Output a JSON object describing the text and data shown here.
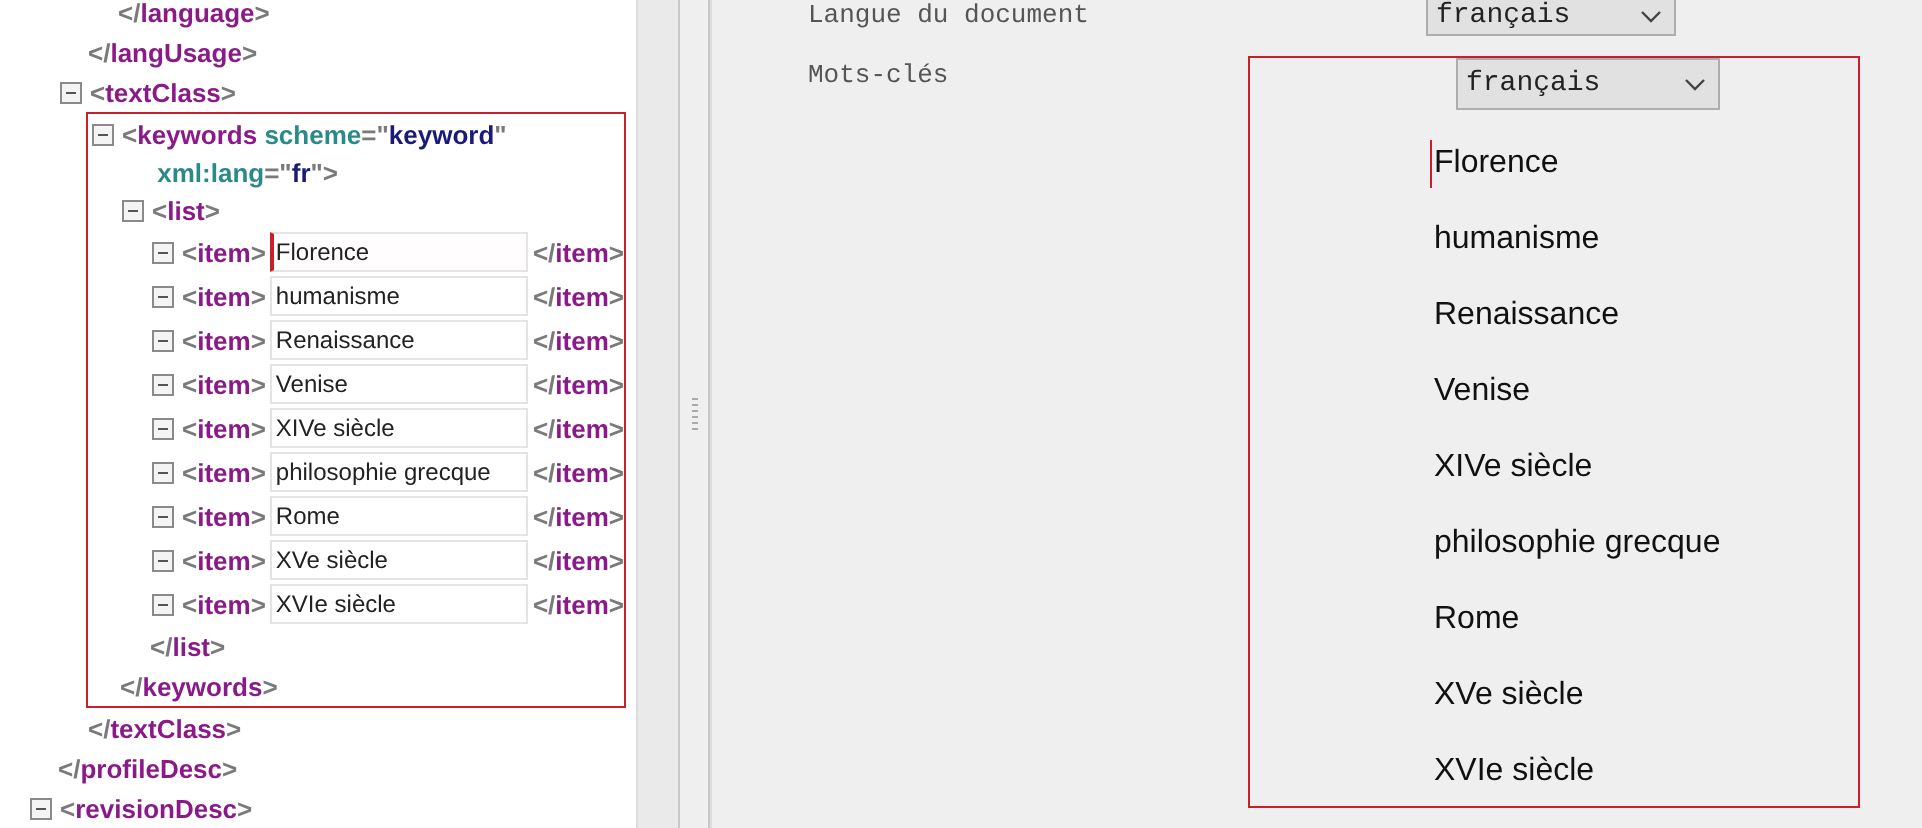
{
  "xml_tree": [
    {
      "kind": "fragment",
      "children": [
        {
          "kind": "fragment",
          "children": [
            {
              "kind": "close",
              "close": "</language>"
            }
          ]
        },
        {
          "kind": "close",
          "close": "</langUsage>"
        },
        {
          "kind": "element",
          "expanded": true,
          "open": [
            [
              {
                "kind": "tag",
                "text": "<textClass>"
              }
            ]
          ],
          "close": "</textClass>",
          "children": [
            {
              "kind": "element",
              "expanded": true,
              "highlighted": true,
              "open": [
                [
                  {
                    "kind": "tag",
                    "text": "<keywords"
                  },
                  {
                    "kind": "attr-name",
                    "text": "scheme"
                  },
                  {
                    "kind": "punct",
                    "text": "=\""
                  },
                  {
                    "kind": "attr-value",
                    "text": "keyword"
                  },
                  {
                    "kind": "punct",
                    "text": "\""
                  }
                ],
                [
                  {
                    "kind": "attr-name",
                    "text": "xml:lang"
                  },
                  {
                    "kind": "punct",
                    "text": "=\""
                  },
                  {
                    "kind": "attr-value",
                    "text": "fr"
                  },
                  {
                    "kind": "punct",
                    "text": "\">"
                  }
                ]
              ],
              "close": "</keywords>",
              "children": [
                {
                  "kind": "element",
                  "expanded": true,
                  "open": [
                    [
                      {
                        "kind": "tag",
                        "text": "<list>"
                      }
                    ]
                  ],
                  "close": "</list>",
                  "children": [
                    {
                      "kind": "item",
                      "expanded": true,
                      "open": "<item>",
                      "value": "Florence",
                      "focused": true,
                      "close": "</item>"
                    },
                    {
                      "kind": "item",
                      "expanded": true,
                      "open": "<item>",
                      "value": "humanisme",
                      "focused": false,
                      "close": "</item>"
                    },
                    {
                      "kind": "item",
                      "expanded": true,
                      "open": "<item>",
                      "value": "Renaissance",
                      "focused": false,
                      "close": "</item>"
                    },
                    {
                      "kind": "item",
                      "expanded": true,
                      "open": "<item>",
                      "value": "Venise",
                      "focused": false,
                      "close": "</item>"
                    },
                    {
                      "kind": "item",
                      "expanded": true,
                      "open": "<item>",
                      "value": "XIVe siècle",
                      "focused": false,
                      "close": "</item>"
                    },
                    {
                      "kind": "item",
                      "expanded": true,
                      "open": "<item>",
                      "value": "philosophie grecque",
                      "focused": false,
                      "close": "</item>"
                    },
                    {
                      "kind": "item",
                      "expanded": true,
                      "open": "<item>",
                      "value": "Rome",
                      "focused": false,
                      "close": "</item>"
                    },
                    {
                      "kind": "item",
                      "expanded": true,
                      "open": "<item>",
                      "value": "XVe siècle",
                      "focused": false,
                      "close": "</item>"
                    },
                    {
                      "kind": "item",
                      "expanded": true,
                      "open": "<item>",
                      "value": "XVIe siècle",
                      "focused": false,
                      "close": "</item>"
                    }
                  ]
                }
              ]
            }
          ]
        }
      ]
    },
    {
      "kind": "close",
      "close": "</profileDesc>"
    },
    {
      "kind": "element",
      "expanded": true,
      "open": [
        [
          {
            "kind": "tag",
            "text": "<revisionDesc>"
          }
        ]
      ]
    }
  ],
  "form": {
    "fields": [
      {
        "kind": "select",
        "label": "Langue du document",
        "value": "français"
      },
      {
        "kind": "keywords",
        "label": "Mots-clés",
        "language": "français",
        "highlighted": true,
        "keywords": [
          {
            "text": "Florence",
            "focused": true
          },
          {
            "text": "humanisme",
            "focused": false
          },
          {
            "text": "Renaissance",
            "focused": false
          },
          {
            "text": "Venise",
            "focused": false
          },
          {
            "text": "XIVe siècle",
            "focused": false
          },
          {
            "text": "philosophie grecque",
            "focused": false
          },
          {
            "text": "Rome",
            "focused": false
          },
          {
            "text": "XVe siècle",
            "focused": false
          },
          {
            "text": "XVIe siècle",
            "focused": false
          }
        ]
      }
    ]
  }
}
